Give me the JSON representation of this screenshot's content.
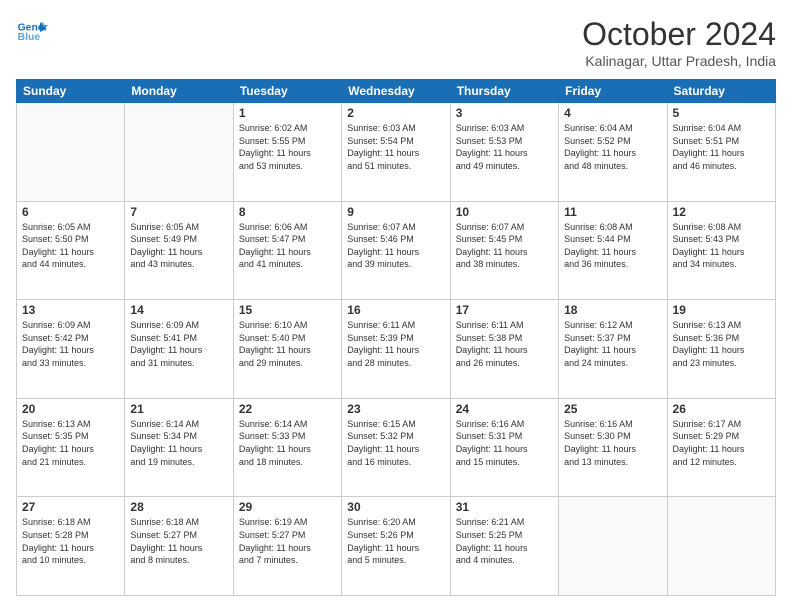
{
  "header": {
    "logo_line1": "General",
    "logo_line2": "Blue",
    "month_title": "October 2024",
    "location": "Kalinagar, Uttar Pradesh, India"
  },
  "days_of_week": [
    "Sunday",
    "Monday",
    "Tuesday",
    "Wednesday",
    "Thursday",
    "Friday",
    "Saturday"
  ],
  "weeks": [
    [
      {
        "day": "",
        "info": ""
      },
      {
        "day": "",
        "info": ""
      },
      {
        "day": "1",
        "info": "Sunrise: 6:02 AM\nSunset: 5:55 PM\nDaylight: 11 hours\nand 53 minutes."
      },
      {
        "day": "2",
        "info": "Sunrise: 6:03 AM\nSunset: 5:54 PM\nDaylight: 11 hours\nand 51 minutes."
      },
      {
        "day": "3",
        "info": "Sunrise: 6:03 AM\nSunset: 5:53 PM\nDaylight: 11 hours\nand 49 minutes."
      },
      {
        "day": "4",
        "info": "Sunrise: 6:04 AM\nSunset: 5:52 PM\nDaylight: 11 hours\nand 48 minutes."
      },
      {
        "day": "5",
        "info": "Sunrise: 6:04 AM\nSunset: 5:51 PM\nDaylight: 11 hours\nand 46 minutes."
      }
    ],
    [
      {
        "day": "6",
        "info": "Sunrise: 6:05 AM\nSunset: 5:50 PM\nDaylight: 11 hours\nand 44 minutes."
      },
      {
        "day": "7",
        "info": "Sunrise: 6:05 AM\nSunset: 5:49 PM\nDaylight: 11 hours\nand 43 minutes."
      },
      {
        "day": "8",
        "info": "Sunrise: 6:06 AM\nSunset: 5:47 PM\nDaylight: 11 hours\nand 41 minutes."
      },
      {
        "day": "9",
        "info": "Sunrise: 6:07 AM\nSunset: 5:46 PM\nDaylight: 11 hours\nand 39 minutes."
      },
      {
        "day": "10",
        "info": "Sunrise: 6:07 AM\nSunset: 5:45 PM\nDaylight: 11 hours\nand 38 minutes."
      },
      {
        "day": "11",
        "info": "Sunrise: 6:08 AM\nSunset: 5:44 PM\nDaylight: 11 hours\nand 36 minutes."
      },
      {
        "day": "12",
        "info": "Sunrise: 6:08 AM\nSunset: 5:43 PM\nDaylight: 11 hours\nand 34 minutes."
      }
    ],
    [
      {
        "day": "13",
        "info": "Sunrise: 6:09 AM\nSunset: 5:42 PM\nDaylight: 11 hours\nand 33 minutes."
      },
      {
        "day": "14",
        "info": "Sunrise: 6:09 AM\nSunset: 5:41 PM\nDaylight: 11 hours\nand 31 minutes."
      },
      {
        "day": "15",
        "info": "Sunrise: 6:10 AM\nSunset: 5:40 PM\nDaylight: 11 hours\nand 29 minutes."
      },
      {
        "day": "16",
        "info": "Sunrise: 6:11 AM\nSunset: 5:39 PM\nDaylight: 11 hours\nand 28 minutes."
      },
      {
        "day": "17",
        "info": "Sunrise: 6:11 AM\nSunset: 5:38 PM\nDaylight: 11 hours\nand 26 minutes."
      },
      {
        "day": "18",
        "info": "Sunrise: 6:12 AM\nSunset: 5:37 PM\nDaylight: 11 hours\nand 24 minutes."
      },
      {
        "day": "19",
        "info": "Sunrise: 6:13 AM\nSunset: 5:36 PM\nDaylight: 11 hours\nand 23 minutes."
      }
    ],
    [
      {
        "day": "20",
        "info": "Sunrise: 6:13 AM\nSunset: 5:35 PM\nDaylight: 11 hours\nand 21 minutes."
      },
      {
        "day": "21",
        "info": "Sunrise: 6:14 AM\nSunset: 5:34 PM\nDaylight: 11 hours\nand 19 minutes."
      },
      {
        "day": "22",
        "info": "Sunrise: 6:14 AM\nSunset: 5:33 PM\nDaylight: 11 hours\nand 18 minutes."
      },
      {
        "day": "23",
        "info": "Sunrise: 6:15 AM\nSunset: 5:32 PM\nDaylight: 11 hours\nand 16 minutes."
      },
      {
        "day": "24",
        "info": "Sunrise: 6:16 AM\nSunset: 5:31 PM\nDaylight: 11 hours\nand 15 minutes."
      },
      {
        "day": "25",
        "info": "Sunrise: 6:16 AM\nSunset: 5:30 PM\nDaylight: 11 hours\nand 13 minutes."
      },
      {
        "day": "26",
        "info": "Sunrise: 6:17 AM\nSunset: 5:29 PM\nDaylight: 11 hours\nand 12 minutes."
      }
    ],
    [
      {
        "day": "27",
        "info": "Sunrise: 6:18 AM\nSunset: 5:28 PM\nDaylight: 11 hours\nand 10 minutes."
      },
      {
        "day": "28",
        "info": "Sunrise: 6:18 AM\nSunset: 5:27 PM\nDaylight: 11 hours\nand 8 minutes."
      },
      {
        "day": "29",
        "info": "Sunrise: 6:19 AM\nSunset: 5:27 PM\nDaylight: 11 hours\nand 7 minutes."
      },
      {
        "day": "30",
        "info": "Sunrise: 6:20 AM\nSunset: 5:26 PM\nDaylight: 11 hours\nand 5 minutes."
      },
      {
        "day": "31",
        "info": "Sunrise: 6:21 AM\nSunset: 5:25 PM\nDaylight: 11 hours\nand 4 minutes."
      },
      {
        "day": "",
        "info": ""
      },
      {
        "day": "",
        "info": ""
      }
    ]
  ]
}
